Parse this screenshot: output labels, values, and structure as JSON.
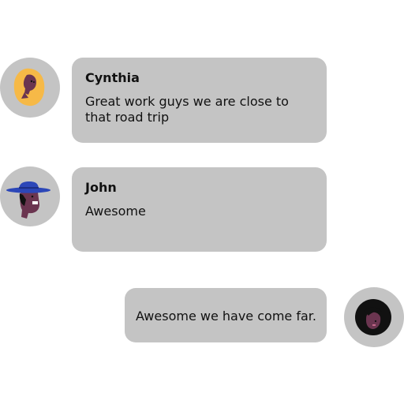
{
  "messages": [
    {
      "sender": "Cynthia",
      "text": "Great work guys we are close to that road trip",
      "avatar_icon": "person-yellow-hair-icon",
      "side": "left"
    },
    {
      "sender": "John",
      "text": "Awesome",
      "avatar_icon": "person-blue-hat-icon",
      "side": "left"
    },
    {
      "sender": "",
      "text": "Awesome we have come far.",
      "avatar_icon": "person-dark-hair-icon",
      "side": "right"
    }
  ],
  "colors": {
    "bubble": "#c4c4c4",
    "avatar_background": "#c4c4c4",
    "text": "#111111",
    "skin": "#6b3550",
    "yellow_hair": "#f6b947",
    "hat_blue": "#2c47b8",
    "dark_hair": "#111111"
  }
}
